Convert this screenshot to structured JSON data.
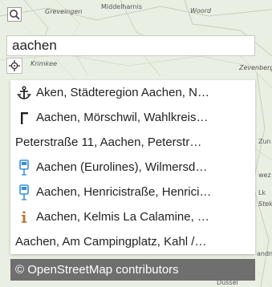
{
  "map": {
    "labels": [
      "Greveingen",
      "Middelharnis",
      "Woord",
      "Krimkee",
      "Zevenberge",
      "Zun",
      "wez",
      "Lk",
      "Stek",
      "andn",
      "Dussel"
    ]
  },
  "search": {
    "value": "aachen",
    "placeholder": ""
  },
  "results": [
    {
      "icon": "anchor-icon",
      "text": "Aken, Städteregion Aachen, N…"
    },
    {
      "icon": "flag-icon",
      "text": "Aachen, Mörschwil, Wahlkreis…"
    },
    {
      "icon": "",
      "text": "Peterstraße 11, Aachen, Peterstr…"
    },
    {
      "icon": "bus-stop-icon",
      "text": "Aachen (Eurolines), Wilmersd…"
    },
    {
      "icon": "bus-stop-icon",
      "text": "Aachen, Henricistraße, Henrici…"
    },
    {
      "icon": "info-icon",
      "text": "Aachen, Kelmis La Calamine, …"
    },
    {
      "icon": "",
      "text": "Aachen, Am Campingplatz, Kahl /…"
    }
  ],
  "attribution": "© OpenStreetMap contributors",
  "colors": {
    "accent": "#3a8fd9",
    "info": "#b9722e",
    "attribution_bg": "#6f6f6f",
    "map_bg": "#e9efe3"
  }
}
